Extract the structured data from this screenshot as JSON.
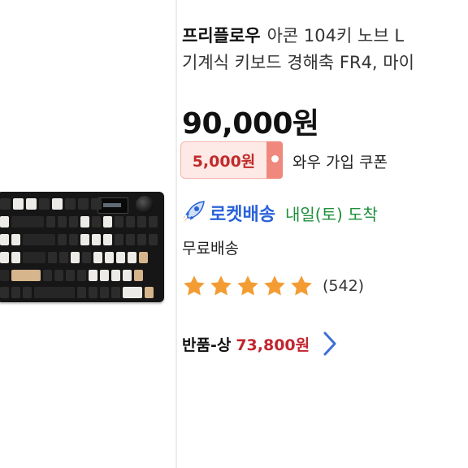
{
  "product": {
    "brand": "프리플로우",
    "title_line1": "아콘 104키 노브 L",
    "title_line2": "기계식 키보드 경해축 FR4, 마이"
  },
  "price": "90,000원",
  "coupon": {
    "amount": "5,000원",
    "label": "와우 가입 쿠폰"
  },
  "delivery": {
    "rocket_label": "로켓배송",
    "arrival": "내일(토) 도착",
    "shipping": "무료배송"
  },
  "rating": {
    "stars": 5,
    "review_count": "(542)"
  },
  "return_deal": {
    "label": "반품-상",
    "price": "73,800원"
  },
  "colors": {
    "rocket_blue": "#2a62d9",
    "arrival_green": "#1e8f3a",
    "star_orange": "#f39c33",
    "price_red": "#c2262e",
    "coupon_red": "#c12b2b",
    "chevron_blue": "#3a6fd8"
  },
  "icons": {
    "rocket": "rocket-icon",
    "star": "star-icon",
    "chevron": "chevron-right-icon"
  }
}
